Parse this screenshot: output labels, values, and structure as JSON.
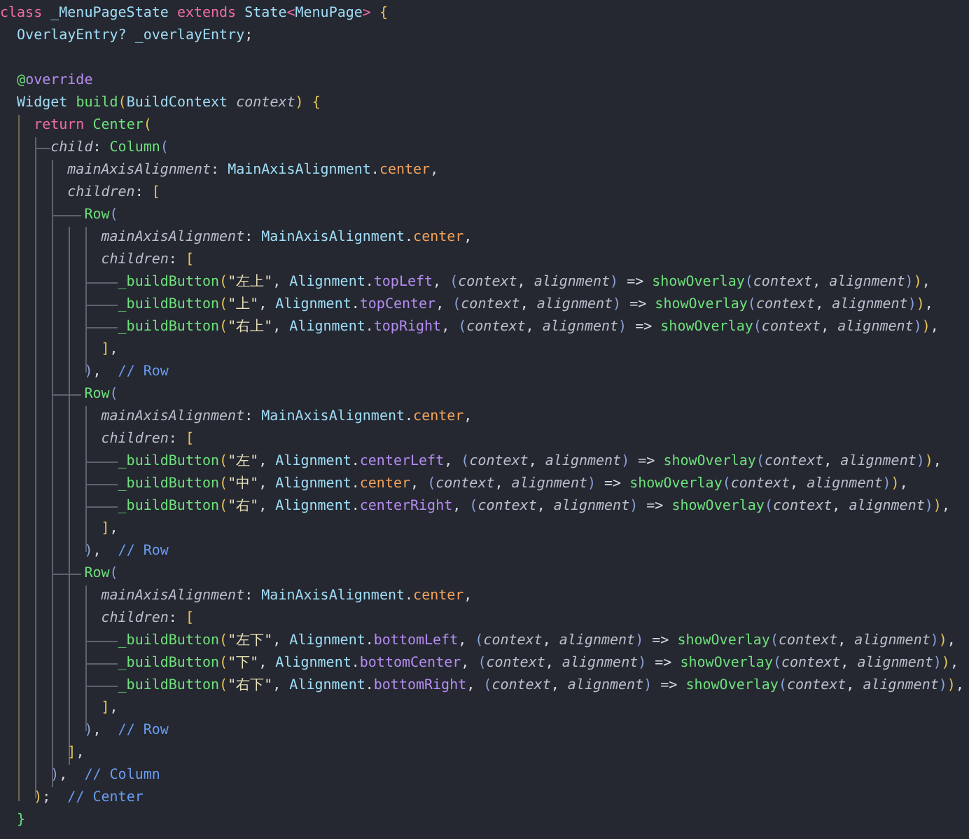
{
  "editor": {
    "lines": [
      {
        "tokens": [
          {
            "t": "class ",
            "kind": "kw"
          },
          {
            "t": "_MenuPageState ",
            "kind": "cls"
          },
          {
            "t": "extends ",
            "kind": "kw"
          },
          {
            "t": "State",
            "kind": "cls"
          },
          {
            "t": "<",
            "kind": "kw"
          },
          {
            "t": "MenuPage",
            "kind": "cls"
          },
          {
            "t": "> ",
            "kind": "kw"
          },
          {
            "t": "{",
            "kind": "pn"
          }
        ]
      },
      {
        "tokens": [
          {
            "t": "  OverlayEntry? ",
            "kind": "cls"
          },
          {
            "t": "_overlayEntry",
            "kind": "cls"
          },
          {
            "t": ";",
            "kind": "op"
          }
        ]
      },
      {
        "tokens": [
          {
            "t": "  @",
            "kind": "an"
          },
          {
            "t": "override",
            "kind": "mb"
          }
        ]
      },
      {
        "tokens": [
          {
            "t": "  Widget ",
            "kind": "cls"
          },
          {
            "t": "build",
            "kind": "fn"
          },
          {
            "t": "(",
            "kind": "pn"
          },
          {
            "t": "BuildContext ",
            "kind": "cls"
          },
          {
            "t": "context",
            "kind": "it"
          },
          {
            "t": ") ",
            "kind": "pn"
          },
          {
            "t": "{",
            "kind": "pn"
          }
        ]
      },
      {
        "tokens": [
          {
            "t": "    return ",
            "kind": "kw"
          },
          {
            "t": "Center",
            "kind": "fn"
          },
          {
            "t": "(",
            "kind": "pn"
          }
        ]
      },
      {
        "tokens": [
          {
            "t": "      child",
            "kind": "it"
          },
          {
            "t": ": ",
            "kind": "op"
          },
          {
            "t": "Column",
            "kind": "fn"
          },
          {
            "t": "(",
            "kind": "pb"
          }
        ]
      },
      {
        "tokens": [
          {
            "t": "        mainAxisAlignment",
            "kind": "it"
          },
          {
            "t": ": ",
            "kind": "op"
          },
          {
            "t": "MainAxisAlignment",
            "kind": "cls"
          },
          {
            "t": ".",
            "kind": "op"
          },
          {
            "t": "center",
            "kind": "pr"
          },
          {
            "t": ",",
            "kind": "op"
          }
        ]
      },
      {
        "tokens": [
          {
            "t": "        children",
            "kind": "it"
          },
          {
            "t": ": ",
            "kind": "op"
          },
          {
            "t": "[",
            "kind": "pn"
          }
        ]
      },
      {
        "tokens": [
          {
            "t": "          Row",
            "kind": "fn"
          },
          {
            "t": "(",
            "kind": "pb"
          }
        ]
      },
      {
        "tokens": [
          {
            "t": "            mainAxisAlignment",
            "kind": "it"
          },
          {
            "t": ": ",
            "kind": "op"
          },
          {
            "t": "MainAxisAlignment",
            "kind": "cls"
          },
          {
            "t": ".",
            "kind": "op"
          },
          {
            "t": "center",
            "kind": "pr"
          },
          {
            "t": ",",
            "kind": "op"
          }
        ]
      },
      {
        "tokens": [
          {
            "t": "            children",
            "kind": "it"
          },
          {
            "t": ": ",
            "kind": "op"
          },
          {
            "t": "[",
            "kind": "pn"
          }
        ]
      },
      {
        "tokens": [
          {
            "t": "              _buildButton",
            "kind": "fn"
          },
          {
            "t": "(",
            "kind": "pn"
          },
          {
            "t": "\"左上\"",
            "kind": "st"
          },
          {
            "t": ", ",
            "kind": "op"
          },
          {
            "t": "Alignment",
            "kind": "cls"
          },
          {
            "t": ".",
            "kind": "op"
          },
          {
            "t": "topLeft",
            "kind": "mb"
          },
          {
            "t": ", ",
            "kind": "op"
          },
          {
            "t": "(",
            "kind": "pb"
          },
          {
            "t": "context",
            "kind": "it"
          },
          {
            "t": ", ",
            "kind": "op"
          },
          {
            "t": "alignment",
            "kind": "it"
          },
          {
            "t": ")",
            "kind": "pb"
          },
          {
            "t": " => ",
            "kind": "op"
          },
          {
            "t": "showOverlay",
            "kind": "fn"
          },
          {
            "t": "(",
            "kind": "pb"
          },
          {
            "t": "context",
            "kind": "it"
          },
          {
            "t": ", ",
            "kind": "op"
          },
          {
            "t": "alignment",
            "kind": "it"
          },
          {
            "t": ")",
            "kind": "pb"
          },
          {
            "t": ")",
            "kind": "pn"
          },
          {
            "t": ",",
            "kind": "op"
          }
        ]
      },
      {
        "tokens": [
          {
            "t": "              _buildButton",
            "kind": "fn"
          },
          {
            "t": "(",
            "kind": "pn"
          },
          {
            "t": "\"上\"",
            "kind": "st"
          },
          {
            "t": ", ",
            "kind": "op"
          },
          {
            "t": "Alignment",
            "kind": "cls"
          },
          {
            "t": ".",
            "kind": "op"
          },
          {
            "t": "topCenter",
            "kind": "mb"
          },
          {
            "t": ", ",
            "kind": "op"
          },
          {
            "t": "(",
            "kind": "pb"
          },
          {
            "t": "context",
            "kind": "it"
          },
          {
            "t": ", ",
            "kind": "op"
          },
          {
            "t": "alignment",
            "kind": "it"
          },
          {
            "t": ")",
            "kind": "pb"
          },
          {
            "t": " => ",
            "kind": "op"
          },
          {
            "t": "showOverlay",
            "kind": "fn"
          },
          {
            "t": "(",
            "kind": "pb"
          },
          {
            "t": "context",
            "kind": "it"
          },
          {
            "t": ", ",
            "kind": "op"
          },
          {
            "t": "alignment",
            "kind": "it"
          },
          {
            "t": ")",
            "kind": "pb"
          },
          {
            "t": ")",
            "kind": "pn"
          },
          {
            "t": ",",
            "kind": "op"
          }
        ]
      },
      {
        "tokens": [
          {
            "t": "              _buildButton",
            "kind": "fn"
          },
          {
            "t": "(",
            "kind": "pn"
          },
          {
            "t": "\"右上\"",
            "kind": "st"
          },
          {
            "t": ", ",
            "kind": "op"
          },
          {
            "t": "Alignment",
            "kind": "cls"
          },
          {
            "t": ".",
            "kind": "op"
          },
          {
            "t": "topRight",
            "kind": "mb"
          },
          {
            "t": ", ",
            "kind": "op"
          },
          {
            "t": "(",
            "kind": "pb"
          },
          {
            "t": "context",
            "kind": "it"
          },
          {
            "t": ", ",
            "kind": "op"
          },
          {
            "t": "alignment",
            "kind": "it"
          },
          {
            "t": ")",
            "kind": "pb"
          },
          {
            "t": " => ",
            "kind": "op"
          },
          {
            "t": "showOverlay",
            "kind": "fn"
          },
          {
            "t": "(",
            "kind": "pb"
          },
          {
            "t": "context",
            "kind": "it"
          },
          {
            "t": ", ",
            "kind": "op"
          },
          {
            "t": "alignment",
            "kind": "it"
          },
          {
            "t": ")",
            "kind": "pb"
          },
          {
            "t": ")",
            "kind": "pn"
          },
          {
            "t": ",",
            "kind": "op"
          }
        ]
      },
      {
        "tokens": [
          {
            "t": "            ]",
            "kind": "pn"
          },
          {
            "t": ",",
            "kind": "op"
          }
        ]
      },
      {
        "tokens": [
          {
            "t": "          )",
            "kind": "pb"
          },
          {
            "t": ",  ",
            "kind": "op"
          },
          {
            "t": "// Row",
            "kind": "cm"
          }
        ]
      },
      {
        "tokens": [
          {
            "t": "          Row",
            "kind": "fn"
          },
          {
            "t": "(",
            "kind": "pb"
          }
        ]
      },
      {
        "tokens": [
          {
            "t": "            mainAxisAlignment",
            "kind": "it"
          },
          {
            "t": ": ",
            "kind": "op"
          },
          {
            "t": "MainAxisAlignment",
            "kind": "cls"
          },
          {
            "t": ".",
            "kind": "op"
          },
          {
            "t": "center",
            "kind": "pr"
          },
          {
            "t": ",",
            "kind": "op"
          }
        ]
      },
      {
        "tokens": [
          {
            "t": "            children",
            "kind": "it"
          },
          {
            "t": ": ",
            "kind": "op"
          },
          {
            "t": "[",
            "kind": "pn"
          }
        ]
      },
      {
        "tokens": [
          {
            "t": "              _buildButton",
            "kind": "fn"
          },
          {
            "t": "(",
            "kind": "pn"
          },
          {
            "t": "\"左\"",
            "kind": "st"
          },
          {
            "t": ", ",
            "kind": "op"
          },
          {
            "t": "Alignment",
            "kind": "cls"
          },
          {
            "t": ".",
            "kind": "op"
          },
          {
            "t": "centerLeft",
            "kind": "mb"
          },
          {
            "t": ", ",
            "kind": "op"
          },
          {
            "t": "(",
            "kind": "pb"
          },
          {
            "t": "context",
            "kind": "it"
          },
          {
            "t": ", ",
            "kind": "op"
          },
          {
            "t": "alignment",
            "kind": "it"
          },
          {
            "t": ")",
            "kind": "pb"
          },
          {
            "t": " => ",
            "kind": "op"
          },
          {
            "t": "showOverlay",
            "kind": "fn"
          },
          {
            "t": "(",
            "kind": "pb"
          },
          {
            "t": "context",
            "kind": "it"
          },
          {
            "t": ", ",
            "kind": "op"
          },
          {
            "t": "alignment",
            "kind": "it"
          },
          {
            "t": ")",
            "kind": "pb"
          },
          {
            "t": ")",
            "kind": "pn"
          },
          {
            "t": ",",
            "kind": "op"
          }
        ]
      },
      {
        "tokens": [
          {
            "t": "              _buildButton",
            "kind": "fn"
          },
          {
            "t": "(",
            "kind": "pn"
          },
          {
            "t": "\"中\"",
            "kind": "st"
          },
          {
            "t": ", ",
            "kind": "op"
          },
          {
            "t": "Alignment",
            "kind": "cls"
          },
          {
            "t": ".",
            "kind": "op"
          },
          {
            "t": "center",
            "kind": "pr"
          },
          {
            "t": ", ",
            "kind": "op"
          },
          {
            "t": "(",
            "kind": "pb"
          },
          {
            "t": "context",
            "kind": "it"
          },
          {
            "t": ", ",
            "kind": "op"
          },
          {
            "t": "alignment",
            "kind": "it"
          },
          {
            "t": ")",
            "kind": "pb"
          },
          {
            "t": " => ",
            "kind": "op"
          },
          {
            "t": "showOverlay",
            "kind": "fn"
          },
          {
            "t": "(",
            "kind": "pb"
          },
          {
            "t": "context",
            "kind": "it"
          },
          {
            "t": ", ",
            "kind": "op"
          },
          {
            "t": "alignment",
            "kind": "it"
          },
          {
            "t": ")",
            "kind": "pb"
          },
          {
            "t": ")",
            "kind": "pn"
          },
          {
            "t": ",",
            "kind": "op"
          }
        ]
      },
      {
        "tokens": [
          {
            "t": "              _buildButton",
            "kind": "fn"
          },
          {
            "t": "(",
            "kind": "pn"
          },
          {
            "t": "\"右\"",
            "kind": "st"
          },
          {
            "t": ", ",
            "kind": "op"
          },
          {
            "t": "Alignment",
            "kind": "cls"
          },
          {
            "t": ".",
            "kind": "op"
          },
          {
            "t": "centerRight",
            "kind": "mb"
          },
          {
            "t": ", ",
            "kind": "op"
          },
          {
            "t": "(",
            "kind": "pb"
          },
          {
            "t": "context",
            "kind": "it"
          },
          {
            "t": ", ",
            "kind": "op"
          },
          {
            "t": "alignment",
            "kind": "it"
          },
          {
            "t": ")",
            "kind": "pb"
          },
          {
            "t": " => ",
            "kind": "op"
          },
          {
            "t": "showOverlay",
            "kind": "fn"
          },
          {
            "t": "(",
            "kind": "pb"
          },
          {
            "t": "context",
            "kind": "it"
          },
          {
            "t": ", ",
            "kind": "op"
          },
          {
            "t": "alignment",
            "kind": "it"
          },
          {
            "t": ")",
            "kind": "pb"
          },
          {
            "t": ")",
            "kind": "pn"
          },
          {
            "t": ",",
            "kind": "op"
          }
        ]
      },
      {
        "tokens": [
          {
            "t": "            ]",
            "kind": "pn"
          },
          {
            "t": ",",
            "kind": "op"
          }
        ]
      },
      {
        "tokens": [
          {
            "t": "          )",
            "kind": "pb"
          },
          {
            "t": ",  ",
            "kind": "op"
          },
          {
            "t": "// Row",
            "kind": "cm"
          }
        ]
      },
      {
        "tokens": [
          {
            "t": "          Row",
            "kind": "fn"
          },
          {
            "t": "(",
            "kind": "pb"
          }
        ]
      },
      {
        "tokens": [
          {
            "t": "            mainAxisAlignment",
            "kind": "it"
          },
          {
            "t": ": ",
            "kind": "op"
          },
          {
            "t": "MainAxisAlignment",
            "kind": "cls"
          },
          {
            "t": ".",
            "kind": "op"
          },
          {
            "t": "center",
            "kind": "pr"
          },
          {
            "t": ",",
            "kind": "op"
          }
        ]
      },
      {
        "tokens": [
          {
            "t": "            children",
            "kind": "it"
          },
          {
            "t": ": ",
            "kind": "op"
          },
          {
            "t": "[",
            "kind": "pn"
          }
        ]
      },
      {
        "tokens": [
          {
            "t": "              _buildButton",
            "kind": "fn"
          },
          {
            "t": "(",
            "kind": "pn"
          },
          {
            "t": "\"左下\"",
            "kind": "st"
          },
          {
            "t": ", ",
            "kind": "op"
          },
          {
            "t": "Alignment",
            "kind": "cls"
          },
          {
            "t": ".",
            "kind": "op"
          },
          {
            "t": "bottomLeft",
            "kind": "mb"
          },
          {
            "t": ", ",
            "kind": "op"
          },
          {
            "t": "(",
            "kind": "pb"
          },
          {
            "t": "context",
            "kind": "it"
          },
          {
            "t": ", ",
            "kind": "op"
          },
          {
            "t": "alignment",
            "kind": "it"
          },
          {
            "t": ")",
            "kind": "pb"
          },
          {
            "t": " => ",
            "kind": "op"
          },
          {
            "t": "showOverlay",
            "kind": "fn"
          },
          {
            "t": "(",
            "kind": "pb"
          },
          {
            "t": "context",
            "kind": "it"
          },
          {
            "t": ", ",
            "kind": "op"
          },
          {
            "t": "alignment",
            "kind": "it"
          },
          {
            "t": ")",
            "kind": "pb"
          },
          {
            "t": ")",
            "kind": "pn"
          },
          {
            "t": ",",
            "kind": "op"
          }
        ]
      },
      {
        "tokens": [
          {
            "t": "              _buildButton",
            "kind": "fn"
          },
          {
            "t": "(",
            "kind": "pn"
          },
          {
            "t": "\"下\"",
            "kind": "st"
          },
          {
            "t": ", ",
            "kind": "op"
          },
          {
            "t": "Alignment",
            "kind": "cls"
          },
          {
            "t": ".",
            "kind": "op"
          },
          {
            "t": "bottomCenter",
            "kind": "mb"
          },
          {
            "t": ", ",
            "kind": "op"
          },
          {
            "t": "(",
            "kind": "pb"
          },
          {
            "t": "context",
            "kind": "it"
          },
          {
            "t": ", ",
            "kind": "op"
          },
          {
            "t": "alignment",
            "kind": "it"
          },
          {
            "t": ")",
            "kind": "pb"
          },
          {
            "t": " => ",
            "kind": "op"
          },
          {
            "t": "showOverlay",
            "kind": "fn"
          },
          {
            "t": "(",
            "kind": "pb"
          },
          {
            "t": "context",
            "kind": "it"
          },
          {
            "t": ", ",
            "kind": "op"
          },
          {
            "t": "alignment",
            "kind": "it"
          },
          {
            "t": ")",
            "kind": "pb"
          },
          {
            "t": ")",
            "kind": "pn"
          },
          {
            "t": ",",
            "kind": "op"
          }
        ]
      },
      {
        "tokens": [
          {
            "t": "              _buildButton",
            "kind": "fn"
          },
          {
            "t": "(",
            "kind": "pn"
          },
          {
            "t": "\"右下\"",
            "kind": "st"
          },
          {
            "t": ", ",
            "kind": "op"
          },
          {
            "t": "Alignment",
            "kind": "cls"
          },
          {
            "t": ".",
            "kind": "op"
          },
          {
            "t": "bottomRight",
            "kind": "mb"
          },
          {
            "t": ", ",
            "kind": "op"
          },
          {
            "t": "(",
            "kind": "pb"
          },
          {
            "t": "context",
            "kind": "it"
          },
          {
            "t": ", ",
            "kind": "op"
          },
          {
            "t": "alignment",
            "kind": "it"
          },
          {
            "t": ")",
            "kind": "pb"
          },
          {
            "t": " => ",
            "kind": "op"
          },
          {
            "t": "showOverlay",
            "kind": "fn"
          },
          {
            "t": "(",
            "kind": "pb"
          },
          {
            "t": "context",
            "kind": "it"
          },
          {
            "t": ", ",
            "kind": "op"
          },
          {
            "t": "alignment",
            "kind": "it"
          },
          {
            "t": ")",
            "kind": "pb"
          },
          {
            "t": ")",
            "kind": "pn"
          },
          {
            "t": ",",
            "kind": "op"
          }
        ]
      },
      {
        "tokens": [
          {
            "t": "            ]",
            "kind": "pn"
          },
          {
            "t": ",",
            "kind": "op"
          }
        ]
      },
      {
        "tokens": [
          {
            "t": "          )",
            "kind": "pb"
          },
          {
            "t": ",  ",
            "kind": "op"
          },
          {
            "t": "// Row",
            "kind": "cm"
          }
        ]
      },
      {
        "tokens": [
          {
            "t": "        ]",
            "kind": "pn"
          },
          {
            "t": ",",
            "kind": "op"
          }
        ]
      },
      {
        "tokens": [
          {
            "t": "      )",
            "kind": "pb"
          },
          {
            "t": ",  ",
            "kind": "op"
          },
          {
            "t": "// Column",
            "kind": "cm"
          }
        ]
      },
      {
        "tokens": [
          {
            "t": "    )",
            "kind": "pn"
          },
          {
            "t": ";  ",
            "kind": "op"
          },
          {
            "t": "// Center",
            "kind": "cm"
          }
        ]
      },
      {
        "tokens": [
          {
            "t": "  }",
            "kind": "fn"
          }
        ]
      }
    ]
  }
}
